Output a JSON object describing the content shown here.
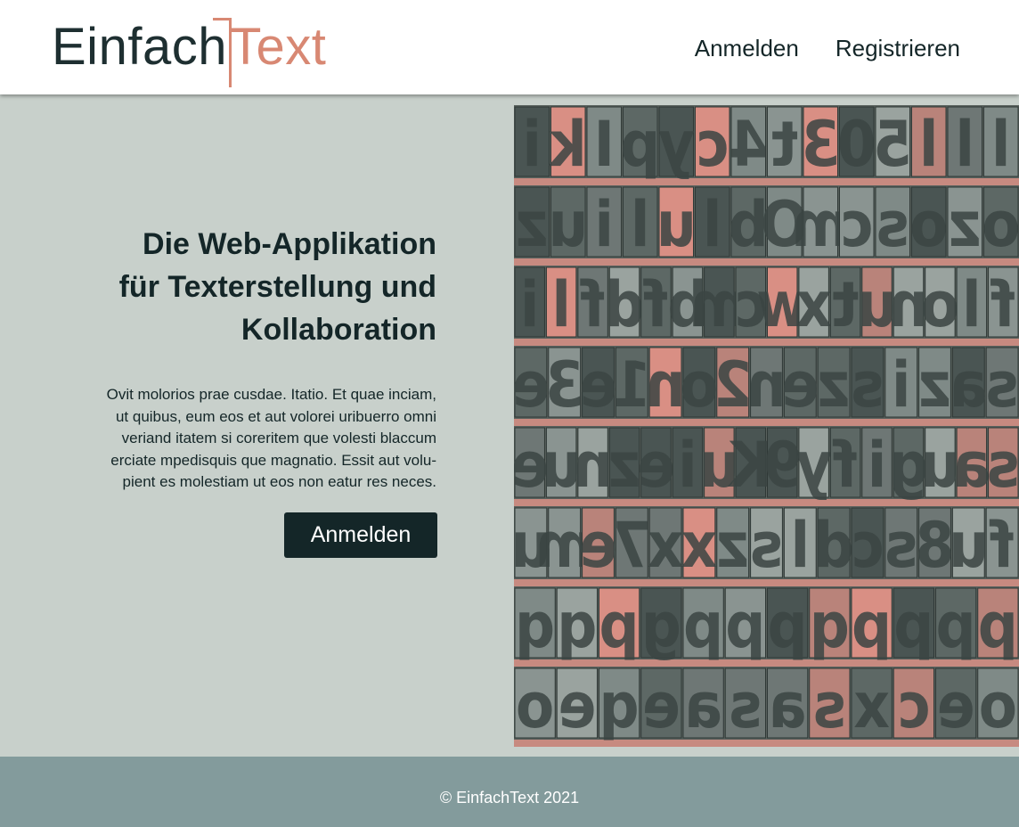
{
  "header": {
    "logo": {
      "part1": "Einfach",
      "part2": "Text"
    },
    "nav": {
      "login": "Anmelden",
      "register": "Registrieren"
    }
  },
  "hero": {
    "title_lines": [
      "Die Web-Applikation",
      "für Texterstellung und",
      "Kollaboration"
    ],
    "body_lines": [
      "Ovit molorios prae cusdae. Itatio. Et quae inciam,",
      "ut quibus, eum eos et aut volorei uribuerro omni",
      "veriand itatem si coreritem que volesti blaccum",
      "erciate mpedisquis que magnatio. Essit aut volu-",
      "pient es molestiam ut eos non eatur res neces."
    ],
    "cta_label": "Anmelden",
    "image": {
      "icon": "letterpress-type-photo",
      "rows": [
        "ikIpyc4t305lll",
        "zuilulbOmcsozo",
        "ilfdfbmcwxtunolf",
        "e3e1no2nezsizas",
        "eunzeiuK9yfiguas",
        "ume7xxzsldcs8uf",
        "qqpgpppqpppp",
        "oeqeasasxceo"
      ]
    }
  },
  "footer": {
    "copyright": "© EinfachText 2021"
  },
  "colors": {
    "dark": "#142628",
    "accent": "#d88873",
    "background": "#c8d0cb",
    "footer": "#839b9c"
  }
}
